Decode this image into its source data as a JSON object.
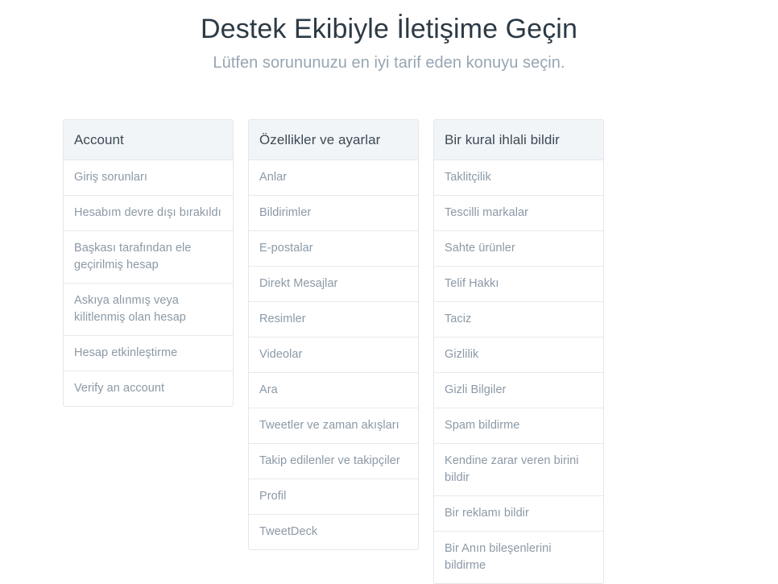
{
  "header": {
    "title": "Destek Ekibiyle İletişime Geçin",
    "subtitle": "Lütfen sorununuzu en iyi tarif eden konuyu seçin."
  },
  "colors": {
    "title_text": "#2c3a45",
    "subtitle_text": "#97a6b3",
    "card_header_bg": "#f1f5f8",
    "card_header_text": "#3d4a55",
    "card_border": "#e3e8ec",
    "row_divider": "#e6eaed",
    "row_text": "#8b99a6",
    "page_bg": "#ffffff"
  },
  "columns": [
    {
      "title": "Account",
      "items": [
        {
          "label": "Giriş sorunları",
          "lines": 1
        },
        {
          "label": "Hesabım devre dışı bırakıldı",
          "lines": 1
        },
        {
          "label": "Başkası tarafından ele geçirilmiş hesap",
          "lines": 2
        },
        {
          "label": "Askıya alınmış veya kilitlenmiş olan hesap",
          "lines": 2
        },
        {
          "label": "Hesap etkinleştirme",
          "lines": 1
        },
        {
          "label": "Verify an account",
          "lines": 1
        }
      ]
    },
    {
      "title": "Özellikler ve ayarlar",
      "items": [
        {
          "label": "Anlar",
          "lines": 1
        },
        {
          "label": "Bildirimler",
          "lines": 1
        },
        {
          "label": "E-postalar",
          "lines": 1
        },
        {
          "label": "Direkt Mesajlar",
          "lines": 1
        },
        {
          "label": "Resimler",
          "lines": 1
        },
        {
          "label": "Videolar",
          "lines": 1
        },
        {
          "label": "Ara",
          "lines": 1
        },
        {
          "label": "Tweetler ve zaman akışları",
          "lines": 1
        },
        {
          "label": "Takip edilenler ve takipçiler",
          "lines": 1
        },
        {
          "label": "Profil",
          "lines": 1
        },
        {
          "label": "TweetDeck",
          "lines": 1
        }
      ]
    },
    {
      "title": "Bir kural ihlali bildir",
      "items": [
        {
          "label": "Taklitçilik",
          "lines": 1
        },
        {
          "label": "Tescilli markalar",
          "lines": 1
        },
        {
          "label": "Sahte ürünler",
          "lines": 1
        },
        {
          "label": "Telif Hakkı",
          "lines": 1
        },
        {
          "label": "Taciz",
          "lines": 1
        },
        {
          "label": "Gizlilik",
          "lines": 1
        },
        {
          "label": "Gizli Bilgiler",
          "lines": 1
        },
        {
          "label": "Spam bildirme",
          "lines": 1
        },
        {
          "label": "Kendine zarar veren birini bildir",
          "lines": 2
        },
        {
          "label": "Bir reklamı bildir",
          "lines": 1
        },
        {
          "label": "Bir Anın bileşenlerini bildirme",
          "lines": 2
        }
      ]
    }
  ]
}
